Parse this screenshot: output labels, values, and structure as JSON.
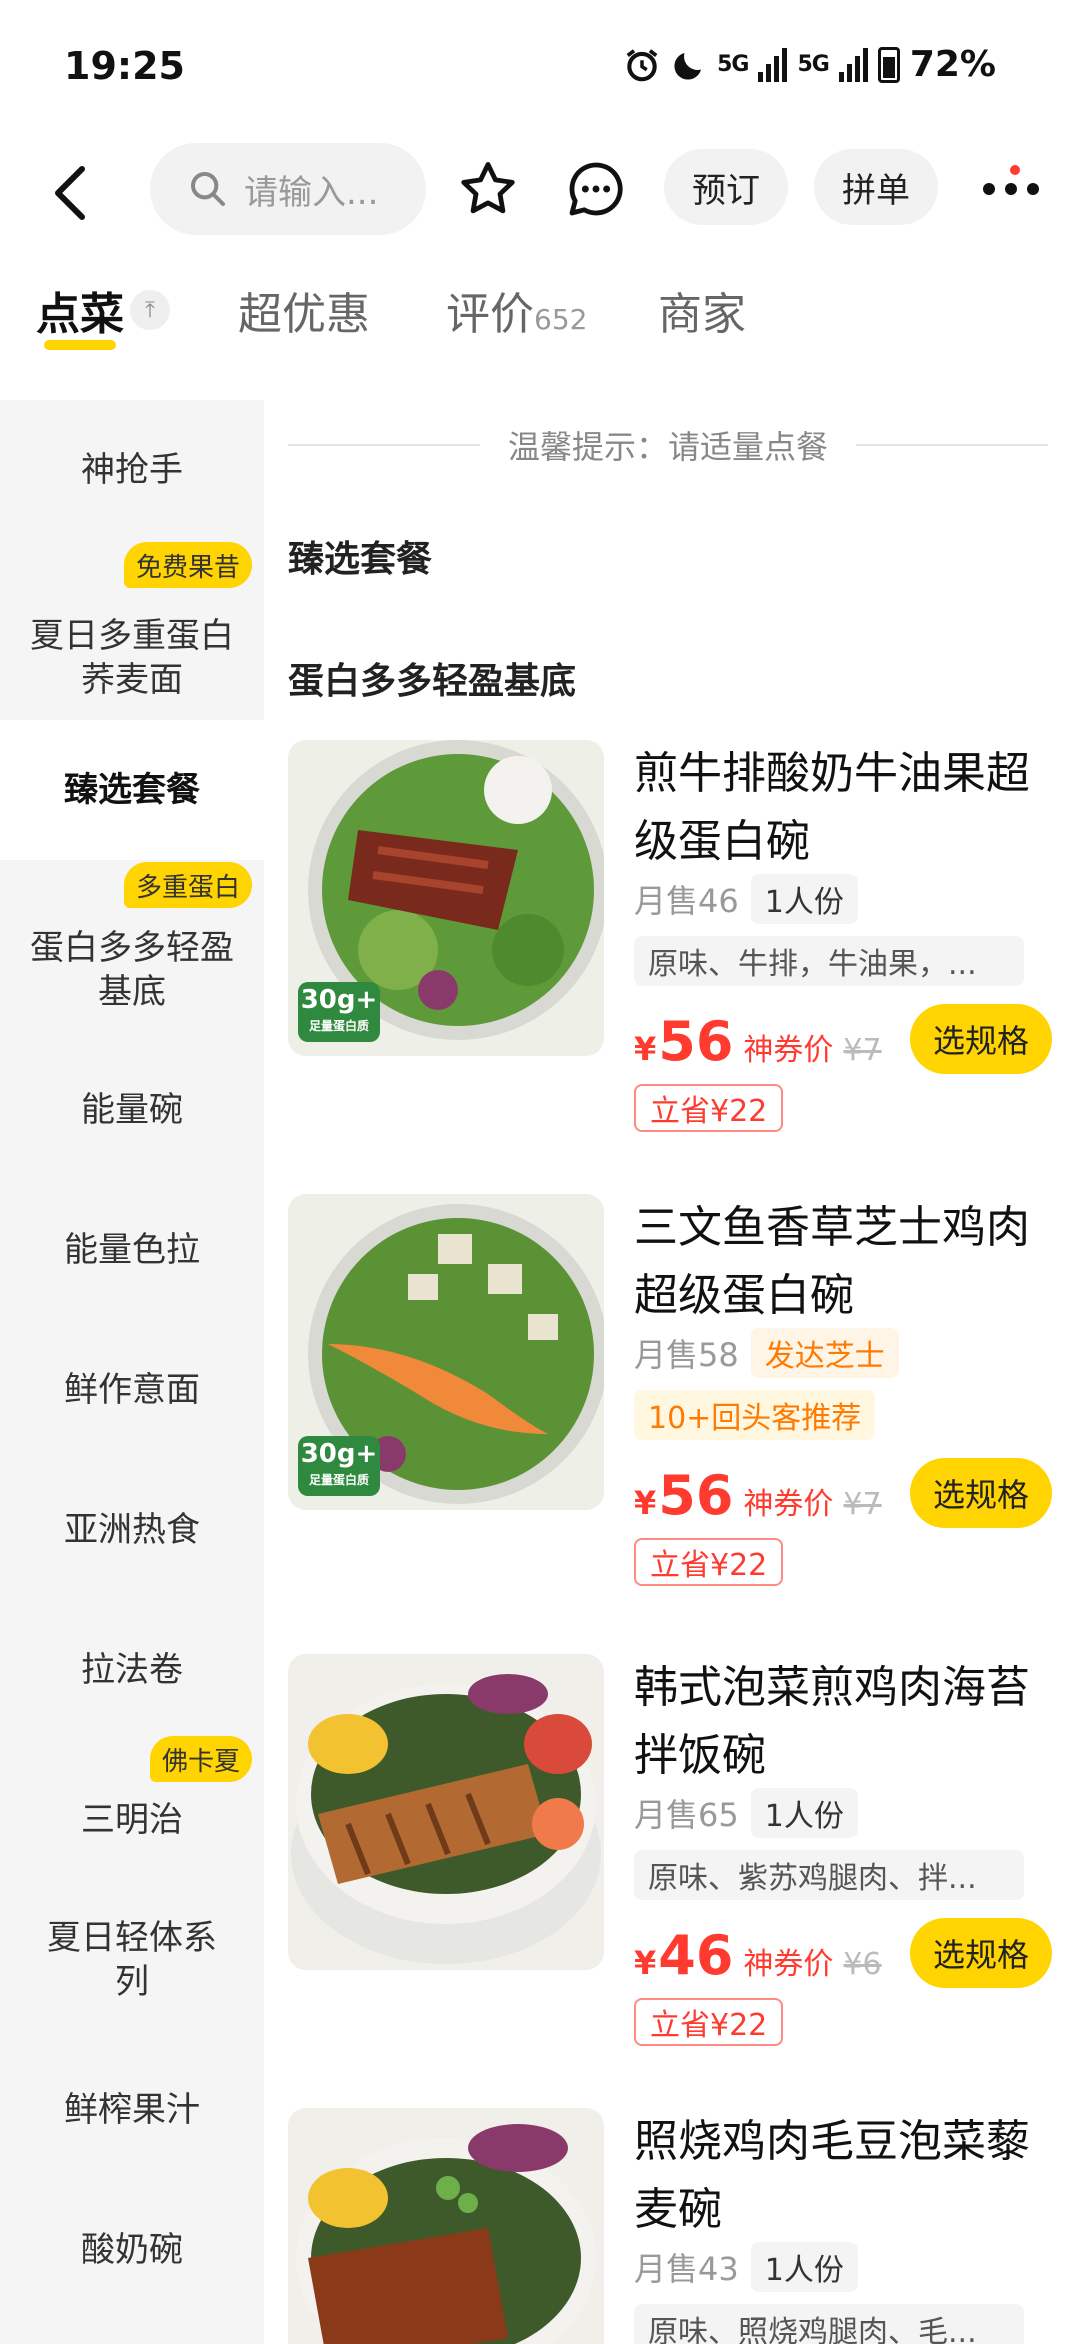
{
  "status_bar": {
    "time": "19:25",
    "net1": "5G",
    "net2": "5G",
    "battery": "72%"
  },
  "nav": {
    "search_placeholder": "请输入...",
    "book_label": "预订",
    "group_label": "拼单"
  },
  "tabs": [
    {
      "label": "点菜",
      "active": true
    },
    {
      "label": "超优惠"
    },
    {
      "label": "评价",
      "count": "652"
    },
    {
      "label": "商家"
    }
  ],
  "sidebar": {
    "items": [
      {
        "label": "神抢手"
      },
      {
        "label": "夏日多重蛋白荞麦面",
        "tag": "免费果昔"
      },
      {
        "label": "臻选套餐",
        "active": true
      },
      {
        "label": "蛋白多多轻盈基底",
        "tag": "多重蛋白"
      },
      {
        "label": "能量碗"
      },
      {
        "label": "能量色拉"
      },
      {
        "label": "鲜作意面"
      },
      {
        "label": "亚洲热食"
      },
      {
        "label": "拉法卷"
      },
      {
        "label": "三明治",
        "tag": "佛卡夏"
      },
      {
        "label": "夏日轻体系列"
      },
      {
        "label": "鲜榨果汁"
      },
      {
        "label": "酸奶碗"
      }
    ]
  },
  "main": {
    "tip": "温馨提示：请适量点餐",
    "section1": "臻选套餐",
    "section2": "蛋白多多轻盈基底",
    "products": [
      {
        "title": "煎牛排酸奶牛油果超级蛋白碗",
        "sales": "月售46",
        "chip": "1人份",
        "desc": "原味、牛排，牛油果，...",
        "price_symbol": "¥",
        "price": "56",
        "price_tag": "神券价",
        "old_price": "¥7",
        "save": "立省¥22",
        "spec": "选规格",
        "badge_big": "30g+",
        "badge_small": "足量蛋白质"
      },
      {
        "title": "三文鱼香草芝士鸡肉超级蛋白碗",
        "sales": "月售58",
        "chip": "发达芝士",
        "chip2": "10+回头客推荐",
        "price_symbol": "¥",
        "price": "56",
        "price_tag": "神券价",
        "old_price": "¥7",
        "save": "立省¥22",
        "spec": "选规格",
        "badge_big": "30g+",
        "badge_small": "足量蛋白质"
      },
      {
        "title": "韩式泡菜煎鸡肉海苔拌饭碗",
        "sales": "月售65",
        "chip": "1人份",
        "desc": "原味、紫苏鸡腿肉、拌...",
        "price_symbol": "¥",
        "price": "46",
        "price_tag": "神券价",
        "old_price": "¥6",
        "save": "立省¥22",
        "spec": "选规格"
      },
      {
        "title": "照烧鸡肉毛豆泡菜藜麦碗",
        "sales": "月售43",
        "chip": "1人份",
        "desc": "原味、照烧鸡腿肉、毛..."
      }
    ]
  }
}
